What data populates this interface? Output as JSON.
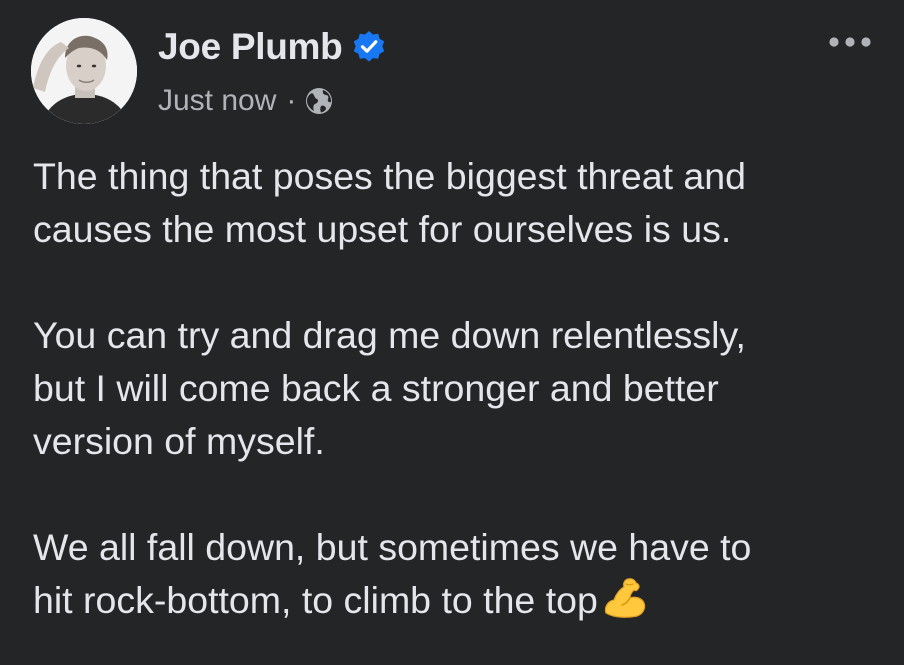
{
  "post": {
    "author": {
      "name": "Joe Plumb",
      "verified": true,
      "verified_icon": "verified-badge-icon",
      "avatar_icon": "profile-photo"
    },
    "meta": {
      "timestamp": "Just now",
      "separator": "·",
      "audience_icon": "globe-icon"
    },
    "more_icon": "more-options-icon",
    "paragraphs": [
      "The thing that poses the biggest threat and\ncauses the most upset for ourselves is us.",
      "You can try and drag me down relentlessly,\nbut I will come back a stronger and better\nversion of myself.",
      "We all fall down, but sometimes we have to\nhit rock-bottom, to climb to the top"
    ],
    "trailing_emoji": "flexed-biceps-emoji"
  },
  "colors": {
    "background": "#242526",
    "primary_text": "#e4e6eb",
    "secondary_text": "#b0b3b8",
    "verified_blue": "#1877f2",
    "emoji_yellow": "#ffc83d"
  }
}
